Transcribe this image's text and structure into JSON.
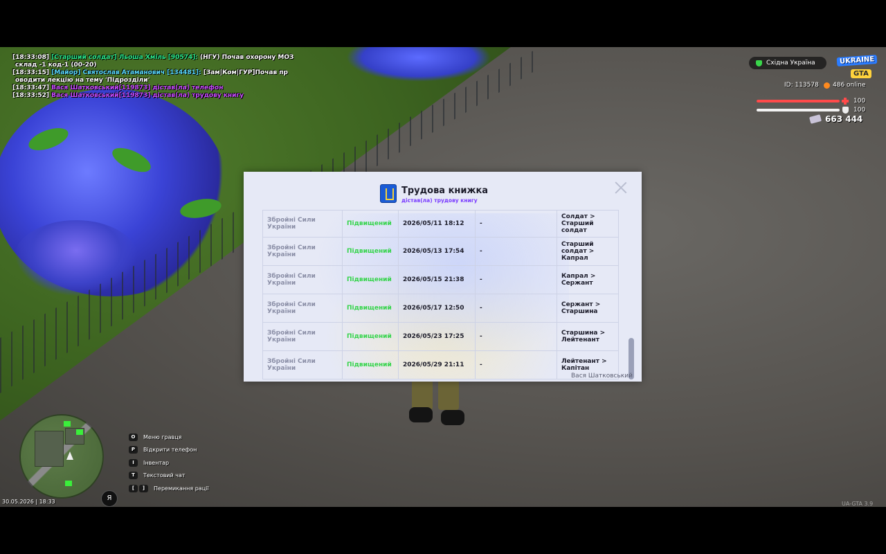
{
  "chat": [
    {
      "time": "[18:33:08]",
      "rank": "[Старший солдат]",
      "name": "Льоша Хміль [90574]:",
      "text": "(НГУ) Почав охорону МОЗ",
      "cont": "склад -1 код-1 (00-20)"
    },
    {
      "time": "[18:33:15]",
      "rank": "[Майор]",
      "name": "Святослав Атаманович [134481]:",
      "text": "[Зам|Ком|ГУР]Почав пр",
      "cont": "оводити лекцію на тему 'Підрозділи'"
    },
    {
      "time": "[18:33:47]",
      "rank": "",
      "name": "Вася Шатковський[119873] дістав(ла) телефон",
      "text": "",
      "cont": ""
    },
    {
      "time": "[18:33:52]",
      "rank": "",
      "name": "Вася Шатковський[119873] дістав(ла) трудову книгу",
      "text": "",
      "cont": ""
    }
  ],
  "hud": {
    "server": "Східна Україна",
    "logo_top": "UKRAINE",
    "logo_bottom": "GTA",
    "id_text": "ID: 113578",
    "online_text": "486 online",
    "health": 100,
    "armor": 100,
    "health_label": "100",
    "armor_label": "100",
    "money": "663 444",
    "colors": {
      "health": "#ff4a4a",
      "armor": "#f2f2f2",
      "online_coin": "#ff8a1e"
    }
  },
  "dialog": {
    "title": "Трудова книжка",
    "subtitle": "дістав(ла) трудову книгу",
    "footer_name": "Вася Шатковський",
    "rows": [
      {
        "unit": "Збройні Сили України",
        "action": "Підвищений",
        "date": "2026/05/11 18:12",
        "dash": "-",
        "rank": "Солдат > Старший солдат"
      },
      {
        "unit": "Збройні Сили України",
        "action": "Підвищений",
        "date": "2026/05/13 17:54",
        "dash": "-",
        "rank": "Старший солдат > Капрал"
      },
      {
        "unit": "Збройні Сили України",
        "action": "Підвищений",
        "date": "2026/05/15 21:38",
        "dash": "-",
        "rank": "Капрал > Сержант"
      },
      {
        "unit": "Збройні Сили України",
        "action": "Підвищений",
        "date": "2026/05/17 12:50",
        "dash": "-",
        "rank": "Сержант > Старшина"
      },
      {
        "unit": "Збройні Сили України",
        "action": "Підвищений",
        "date": "2026/05/23 17:25",
        "dash": "-",
        "rank": "Старшина > Лейтенант"
      },
      {
        "unit": "Збройні Сили України",
        "action": "Підвищений",
        "date": "2026/05/29 21:11",
        "dash": "-",
        "rank": "Лейтенант > Капітан"
      }
    ]
  },
  "hints": [
    {
      "keys": [
        "O"
      ],
      "label": "Меню гравця"
    },
    {
      "keys": [
        "P"
      ],
      "label": "Відкрити телефон"
    },
    {
      "keys": [
        "I"
      ],
      "label": "Інвентар"
    },
    {
      "keys": [
        "T"
      ],
      "label": "Текстовий чат"
    },
    {
      "keys": [
        "[",
        "]"
      ],
      "label": "Перемикання рації"
    }
  ],
  "minimap": {
    "mic_label": "Я"
  },
  "clock": "30.05.2026 | 18:33",
  "version": "UA-GTA 3.9"
}
